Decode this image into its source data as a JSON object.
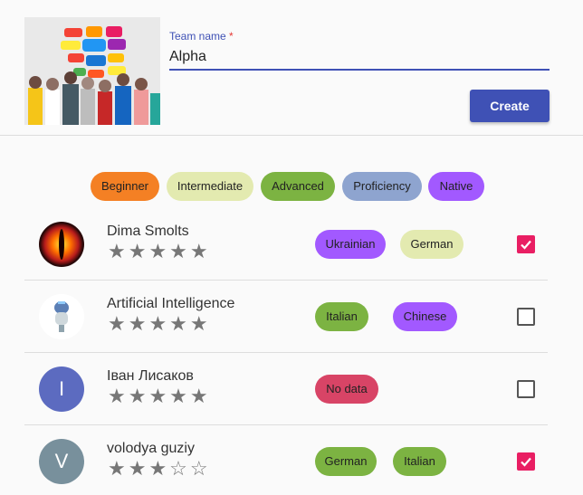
{
  "team_form": {
    "label": "Team name",
    "required_mark": "*",
    "value": "Alpha",
    "create_label": "Create"
  },
  "levels": [
    {
      "label": "Beginner",
      "color": "#f48024"
    },
    {
      "label": "Intermediate",
      "color": "#e3eab0"
    },
    {
      "label": "Advanced",
      "color": "#7cb342"
    },
    {
      "label": "Proficiency",
      "color": "#8ea4cf"
    },
    {
      "label": "Native",
      "color": "#a259ff"
    }
  ],
  "members": [
    {
      "name": "Dima Smolts",
      "rating": 5,
      "stars": "★★★★★",
      "avatar": "eye-image",
      "initial": "",
      "languages": [
        "Ukrainian",
        "German"
      ],
      "selected": true
    },
    {
      "name": "Artificial Intelligence",
      "rating": 5,
      "stars": "★★★★★",
      "avatar": "robot-image",
      "initial": "",
      "languages": [
        "Italian",
        "Chinese"
      ],
      "selected": false
    },
    {
      "name": "Іван Лисаков",
      "rating": 5,
      "stars": "★★★★★",
      "avatar": "initial",
      "initial": "I",
      "languages": [
        "No data"
      ],
      "selected": false
    },
    {
      "name": "volodya guziy",
      "rating": 3,
      "stars": "★★★☆☆",
      "avatar": "initial",
      "initial": "V",
      "languages": [
        "German",
        "Italian"
      ],
      "selected": true
    }
  ],
  "colors": {
    "primary": "#3f51b5",
    "checked": "#e91e63",
    "no_data": "#d84466",
    "avatar_i": "#5c6bc0",
    "avatar_v": "#78909c"
  }
}
